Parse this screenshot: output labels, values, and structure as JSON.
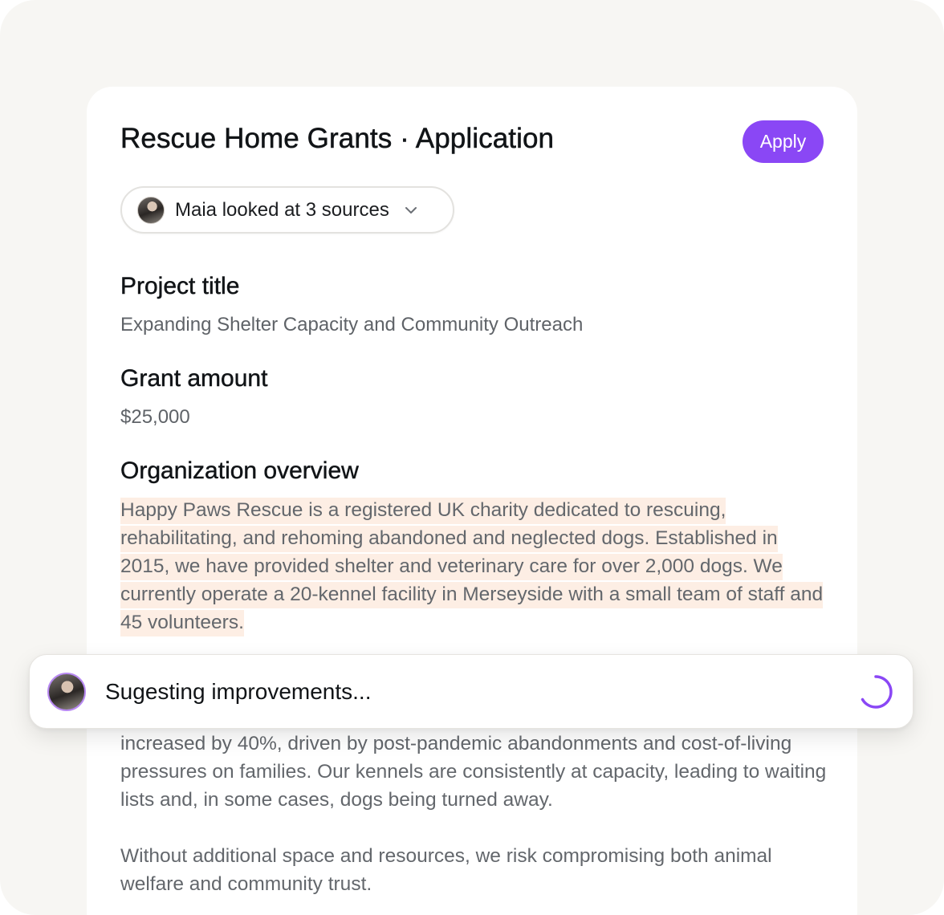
{
  "page": {
    "title": "Rescue Home Grants · Application",
    "apply_label": "Apply"
  },
  "sources": {
    "label": "Maia looked at 3 sources",
    "avatar_icon": "user-avatar-icon",
    "chevron_icon": "chevron-down-icon"
  },
  "sections": {
    "project_title": {
      "heading": "Project title",
      "value": "Expanding Shelter Capacity and Community Outreach"
    },
    "grant_amount": {
      "heading": "Grant amount",
      "value": "$25,000"
    },
    "org_overview": {
      "heading": "Organization overview",
      "body": "Happy Paws Rescue is a registered UK charity dedicated to rescuing, rehabilitating, and rehoming abandoned and neglected dogs. Established in 2015, we have provided shelter and veterinary care for over 2,000 dogs. We currently operate a 20-kennel facility in Merseyside with a small team of staff and 45 volunteers."
    },
    "need": {
      "body_1": "increased by 40%, driven by post-pandemic abandonments and cost-of-living pressures on families. Our kennels are consistently at capacity, leading to waiting lists and, in some cases, dogs being turned away.",
      "body_2": "Without additional space and resources, we risk compromising both animal welfare and community trust."
    }
  },
  "status": {
    "text": "Sugesting improvements...",
    "spinner_icon": "loading-spinner-icon"
  },
  "colors": {
    "accent": "#8a47f5",
    "highlight": "#fdeee4",
    "background": "#f7f6f3"
  }
}
